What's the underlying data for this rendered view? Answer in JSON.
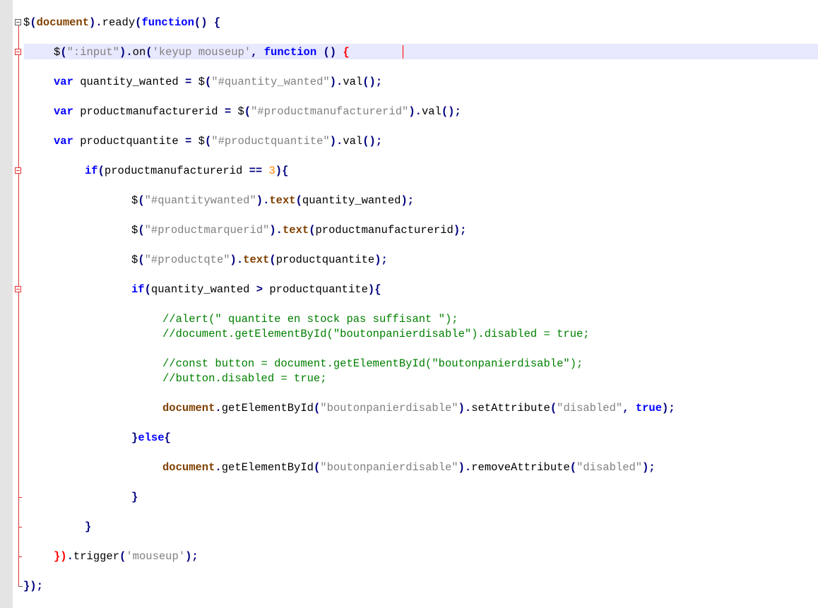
{
  "editor": {
    "lines": [
      {
        "tokens": [
          [
            "id",
            "$"
          ],
          [
            "op",
            "("
          ],
          [
            "fn",
            "document"
          ],
          [
            "op",
            ")."
          ],
          [
            "id",
            "ready"
          ],
          [
            "op",
            "("
          ],
          [
            "kw",
            "function"
          ],
          [
            "op",
            "()"
          ],
          [
            "id",
            " "
          ],
          [
            "op",
            "{"
          ]
        ]
      },
      {
        "tokens": [
          [
            "id",
            "$"
          ],
          [
            "op",
            "("
          ],
          [
            "str",
            "\":input\""
          ],
          [
            "op",
            ")."
          ],
          [
            "id",
            "on"
          ],
          [
            "op",
            "("
          ],
          [
            "str",
            "'keyup mouseup'"
          ],
          [
            "op",
            ","
          ],
          [
            "id",
            " "
          ],
          [
            "kw",
            "function"
          ],
          [
            "id",
            " "
          ],
          [
            "op",
            "()"
          ],
          [
            "id",
            " "
          ],
          [
            "red",
            "{"
          ]
        ]
      },
      {
        "tokens": [
          [
            "kw",
            "var"
          ],
          [
            "id",
            " quantity_wanted "
          ],
          [
            "op",
            "="
          ],
          [
            "id",
            " $"
          ],
          [
            "op",
            "("
          ],
          [
            "str",
            "\"#quantity_wanted\""
          ],
          [
            "op",
            ")."
          ],
          [
            "id",
            "val"
          ],
          [
            "op",
            "();"
          ]
        ]
      },
      {
        "tokens": [
          [
            "kw",
            "var"
          ],
          [
            "id",
            " productmanufacturerid "
          ],
          [
            "op",
            "="
          ],
          [
            "id",
            " $"
          ],
          [
            "op",
            "("
          ],
          [
            "str",
            "\"#productmanufacturerid\""
          ],
          [
            "op",
            ")."
          ],
          [
            "id",
            "val"
          ],
          [
            "op",
            "();"
          ]
        ]
      },
      {
        "tokens": [
          [
            "kw",
            "var"
          ],
          [
            "id",
            " productquantite "
          ],
          [
            "op",
            "="
          ],
          [
            "id",
            " $"
          ],
          [
            "op",
            "("
          ],
          [
            "str",
            "\"#productquantite\""
          ],
          [
            "op",
            ")."
          ],
          [
            "id",
            "val"
          ],
          [
            "op",
            "();"
          ]
        ]
      },
      {
        "tokens": [
          [
            "kw",
            "if"
          ],
          [
            "op",
            "("
          ],
          [
            "id",
            "productmanufacturerid "
          ],
          [
            "op",
            "=="
          ],
          [
            "id",
            " "
          ],
          [
            "num",
            "3"
          ],
          [
            "op",
            "){"
          ]
        ]
      },
      {
        "tokens": [
          [
            "id",
            "$"
          ],
          [
            "op",
            "("
          ],
          [
            "str",
            "\"#quantitywanted\""
          ],
          [
            "op",
            ")."
          ],
          [
            "fn",
            "text"
          ],
          [
            "op",
            "("
          ],
          [
            "id",
            "quantity_wanted"
          ],
          [
            "op",
            ");"
          ]
        ]
      },
      {
        "tokens": [
          [
            "id",
            "$"
          ],
          [
            "op",
            "("
          ],
          [
            "str",
            "\"#productmarquerid\""
          ],
          [
            "op",
            ")."
          ],
          [
            "fn",
            "text"
          ],
          [
            "op",
            "("
          ],
          [
            "id",
            "productmanufacturerid"
          ],
          [
            "op",
            ");"
          ]
        ]
      },
      {
        "tokens": [
          [
            "id",
            "$"
          ],
          [
            "op",
            "("
          ],
          [
            "str",
            "\"#productqte\""
          ],
          [
            "op",
            ")."
          ],
          [
            "fn",
            "text"
          ],
          [
            "op",
            "("
          ],
          [
            "id",
            "productquantite"
          ],
          [
            "op",
            ");"
          ]
        ]
      },
      {
        "tokens": [
          [
            "kw",
            "if"
          ],
          [
            "op",
            "("
          ],
          [
            "id",
            "quantity_wanted "
          ],
          [
            "op",
            ">"
          ],
          [
            "id",
            " productquantite"
          ],
          [
            "op",
            "){"
          ]
        ]
      },
      {
        "tokens": [
          [
            "cm",
            "//alert(\" quantite en stock pas suffisant \");"
          ]
        ]
      },
      {
        "tokens": [
          [
            "cm",
            "//document.getElementById(\"boutonpanierdisable\").disabled = true;"
          ]
        ]
      },
      {
        "tokens": [
          [
            "cm",
            "//const button = document.getElementById(\"boutonpanierdisable\");"
          ]
        ]
      },
      {
        "tokens": [
          [
            "cm",
            "//button.disabled = true;"
          ]
        ]
      },
      {
        "tokens": [
          [
            "fn",
            "document"
          ],
          [
            "op",
            "."
          ],
          [
            "id",
            "getElementById"
          ],
          [
            "op",
            "("
          ],
          [
            "str",
            "\"boutonpanierdisable\""
          ],
          [
            "op",
            ")."
          ],
          [
            "id",
            "setAttribute"
          ],
          [
            "op",
            "("
          ],
          [
            "str",
            "\"disabled\""
          ],
          [
            "op",
            ","
          ],
          [
            "id",
            " "
          ],
          [
            "kw",
            "true"
          ],
          [
            "op",
            ");"
          ]
        ]
      },
      {
        "tokens": [
          [
            "op",
            "}"
          ],
          [
            "kw",
            "else"
          ],
          [
            "op",
            "{"
          ]
        ]
      },
      {
        "tokens": [
          [
            "fn",
            "document"
          ],
          [
            "op",
            "."
          ],
          [
            "id",
            "getElementById"
          ],
          [
            "op",
            "("
          ],
          [
            "str",
            "\"boutonpanierdisable\""
          ],
          [
            "op",
            ")."
          ],
          [
            "id",
            "removeAttribute"
          ],
          [
            "op",
            "("
          ],
          [
            "str",
            "\"disabled\""
          ],
          [
            "op",
            ");"
          ]
        ]
      },
      {
        "tokens": [
          [
            "op",
            "}"
          ]
        ]
      },
      {
        "tokens": [
          [
            "op",
            "}"
          ]
        ]
      },
      {
        "tokens": [
          [
            "red",
            "})"
          ],
          [
            "op",
            "."
          ],
          [
            "id",
            "trigger"
          ],
          [
            "op",
            "("
          ],
          [
            "str",
            "'mouseup'"
          ],
          [
            "op",
            ");"
          ]
        ]
      },
      {
        "tokens": [
          [
            "op",
            "});"
          ]
        ]
      }
    ]
  }
}
